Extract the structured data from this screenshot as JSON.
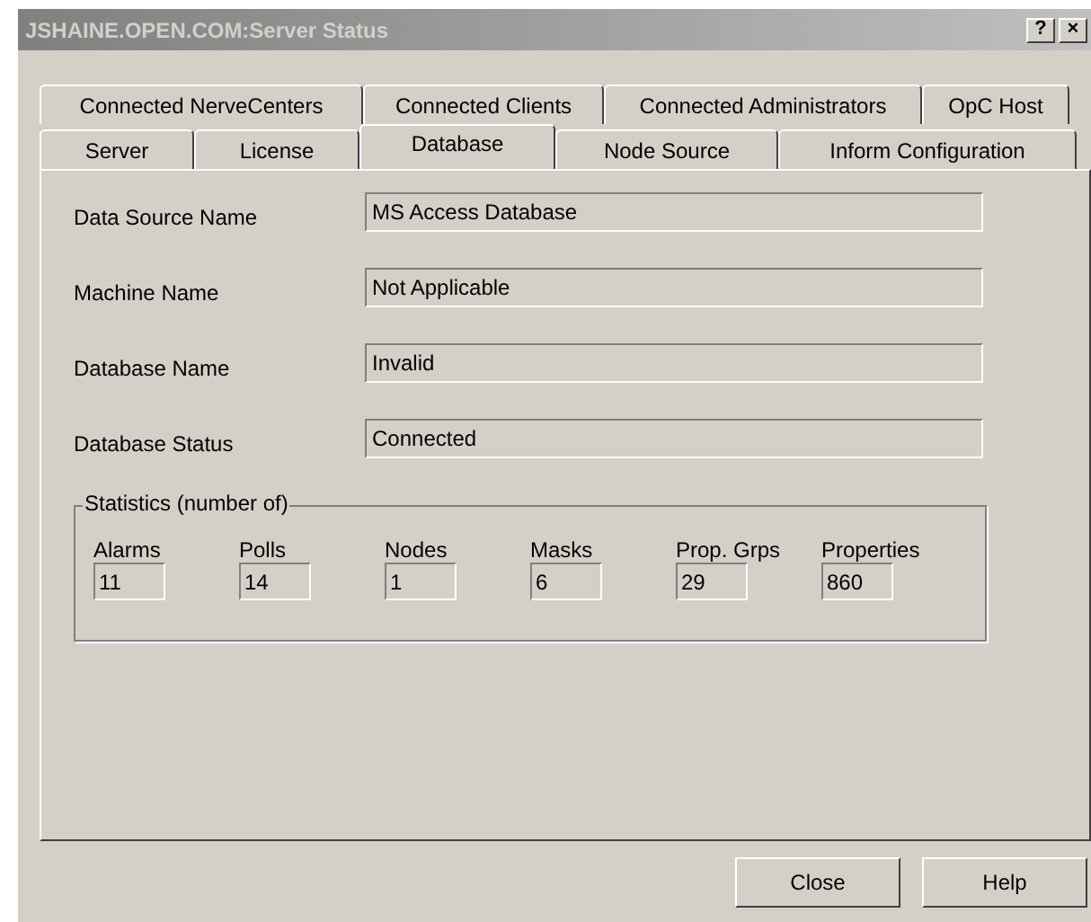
{
  "window": {
    "title": "JSHAINE.OPEN.COM:Server Status",
    "title_buttons": [
      "?",
      "×"
    ]
  },
  "tab_rows": [
    [
      {
        "label": "Connected NerveCenters",
        "selected": false
      },
      {
        "label": "Connected Clients",
        "selected": false
      },
      {
        "label": "Connected Administrators",
        "selected": false
      },
      {
        "label": "OpC Host",
        "selected": false
      }
    ],
    [
      {
        "label": "Server",
        "selected": false
      },
      {
        "label": "License",
        "selected": false
      },
      {
        "label": "Database",
        "selected": true
      },
      {
        "label": "Node Source",
        "selected": false
      },
      {
        "label": "Inform Configuration",
        "selected": false
      }
    ]
  ],
  "fields": [
    {
      "label": "Data Source Name",
      "value": "MS Access Database"
    },
    {
      "label": "Machine Name",
      "value": "Not Applicable"
    },
    {
      "label": "Database Name",
      "value": "Invalid"
    },
    {
      "label": "Database Status",
      "value": "Connected"
    }
  ],
  "statistics": {
    "title": "Statistics (number of)",
    "items": [
      {
        "label": "Alarms",
        "value": "11"
      },
      {
        "label": "Polls",
        "value": "14"
      },
      {
        "label": "Nodes",
        "value": "1"
      },
      {
        "label": "Masks",
        "value": "6"
      },
      {
        "label": "Prop. Grps",
        "value": "29"
      },
      {
        "label": "Properties",
        "value": "860"
      }
    ]
  },
  "buttons": [
    "Close",
    "Help"
  ]
}
